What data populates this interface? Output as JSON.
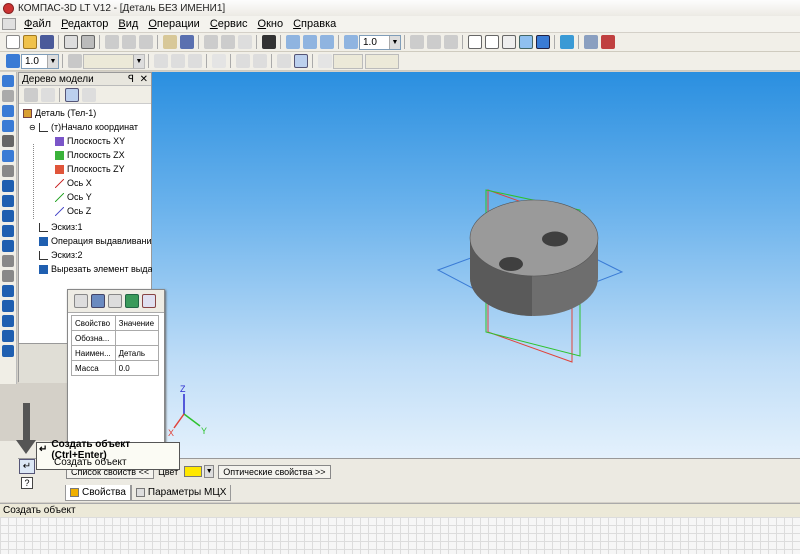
{
  "window": {
    "title": "КОМПАС-3D LT V12 - [Деталь БЕЗ ИМЕНИ1]"
  },
  "menu": [
    "Файл",
    "Редактор",
    "Вид",
    "Операции",
    "Сервис",
    "Окно",
    "Справка"
  ],
  "toolbar": {
    "zoom_value": "1.0",
    "step_value": "1.0"
  },
  "tree": {
    "panel_title": "Дерево модели",
    "pin_glyph": "ꟼ",
    "close_glyph": "✕",
    "items": [
      {
        "label": "Деталь (Тел-1)"
      },
      {
        "label": "(т)Начало координат"
      },
      {
        "label": "Плоскость XY"
      },
      {
        "label": "Плоскость ZX"
      },
      {
        "label": "Плоскость ZY"
      },
      {
        "label": "Ось X"
      },
      {
        "label": "Ось Y"
      },
      {
        "label": "Ось Z"
      },
      {
        "label": "Эскиз:1"
      },
      {
        "label": "Операция выдавливания"
      },
      {
        "label": "Эскиз:2"
      },
      {
        "label": "Вырезать элемент выдав"
      }
    ]
  },
  "properties": {
    "headers": [
      "Свойство",
      "Значение"
    ],
    "rows": [
      {
        "name": "Обозна...",
        "value": ""
      },
      {
        "name": "Наимен...",
        "value": "Деталь"
      },
      {
        "name": "Масса",
        "value": "0.0"
      }
    ]
  },
  "tooltip": {
    "title": "Создать объект (Ctrl+Enter)",
    "subtitle": "Создать объект"
  },
  "property_bar": {
    "list_label": "Список свойств",
    "list_arrow": "<<",
    "color_label": "Цвет",
    "optical_label": "Оптические свойства",
    "optical_arrow": ">>"
  },
  "tabs": [
    "Свойства",
    "Параметры МЦХ"
  ],
  "axes": {
    "x": "X",
    "y": "Y",
    "z": "Z"
  },
  "status": {
    "text": "Создать объект"
  },
  "colors": {
    "plane_xy": "#3a7bd5",
    "plane_zx": "#2ec22e",
    "plane_zy": "#e0433a",
    "part_body": "#8a8a8a"
  }
}
